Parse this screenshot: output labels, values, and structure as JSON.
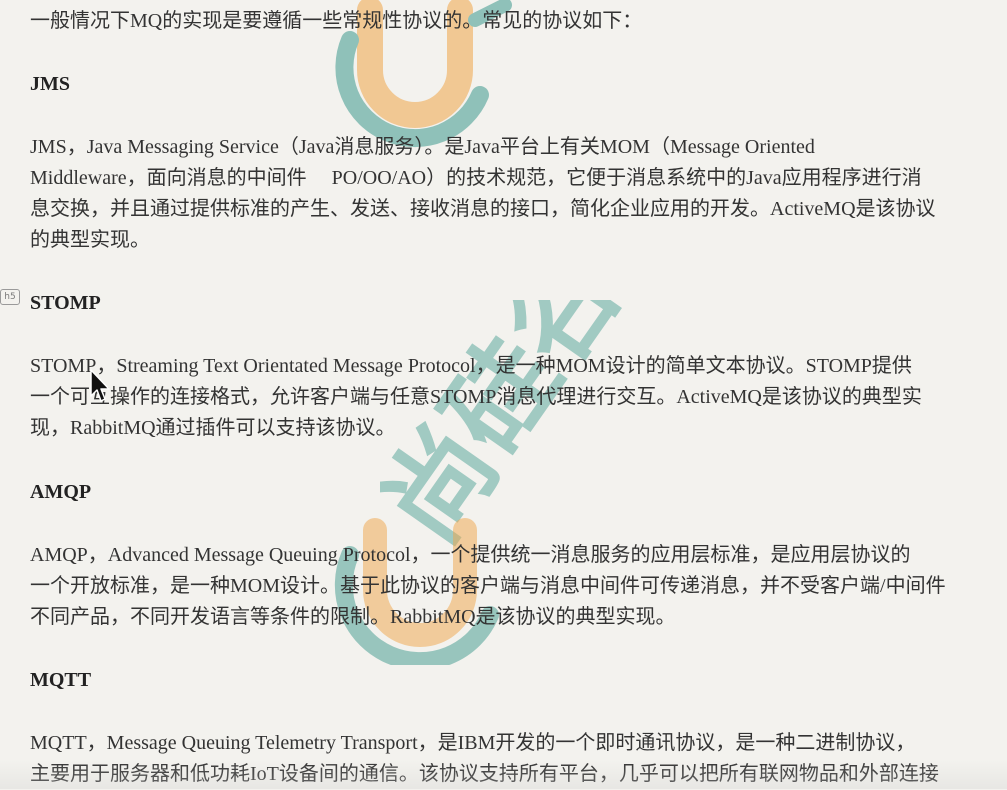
{
  "intro": "一般情况下MQ的实现是要遵循一些常规性协议的。常见的协议如下：",
  "heading_marker": "h5",
  "sections": [
    {
      "heading": "JMS",
      "lines": [
        "JMS，Java Messaging Service（Java消息服务）。是Java平台上有关MOM（Message Oriented",
        "Middleware，面向消息的中间件　 PO/OO/AO）的技术规范，它便于消息系统中的Java应用程序进行消",
        "息交换，并且通过提供标准的产生、发送、接收消息的接口，简化企业应用的开发。ActiveMQ是该协议",
        "的典型实现。"
      ]
    },
    {
      "heading": "STOMP",
      "lines": [
        "STOMP，Streaming Text Orientated Message Protocol，是一种MOM设计的简单文本协议。STOMP提供",
        "一个可互操作的连接格式，允许客户端与任意STOMP消息代理进行交互。ActiveMQ是该协议的典型实",
        "现，RabbitMQ通过插件可以支持该协议。"
      ]
    },
    {
      "heading": "AMQP",
      "lines": [
        "AMQP，Advanced Message Queuing Protocol，一个提供统一消息服务的应用层标准，是应用层协议的",
        "一个开放标准，是一种MOM设计。基于此协议的客户端与消息中间件可传递消息，并不受客户端/中间件",
        "不同产品，不同开发语言等条件的限制。RabbitMQ是该协议的典型实现。"
      ]
    },
    {
      "heading": "MQTT",
      "lines": [
        "MQTT，Message Queuing Telemetry Transport，是IBM开发的一个即时通讯协议，是一种二进制协议，",
        "主要用于服务器和低功耗IoT设备间的通信。该协议支持所有平台，几乎可以把所有联网物品和外部连接"
      ]
    }
  ],
  "watermark": {
    "text": "尚硅谷",
    "orange": "#f0a64a",
    "teal": "#3f9a8e"
  },
  "colors": {
    "background": "#f3f2ee",
    "text": "#333333"
  }
}
